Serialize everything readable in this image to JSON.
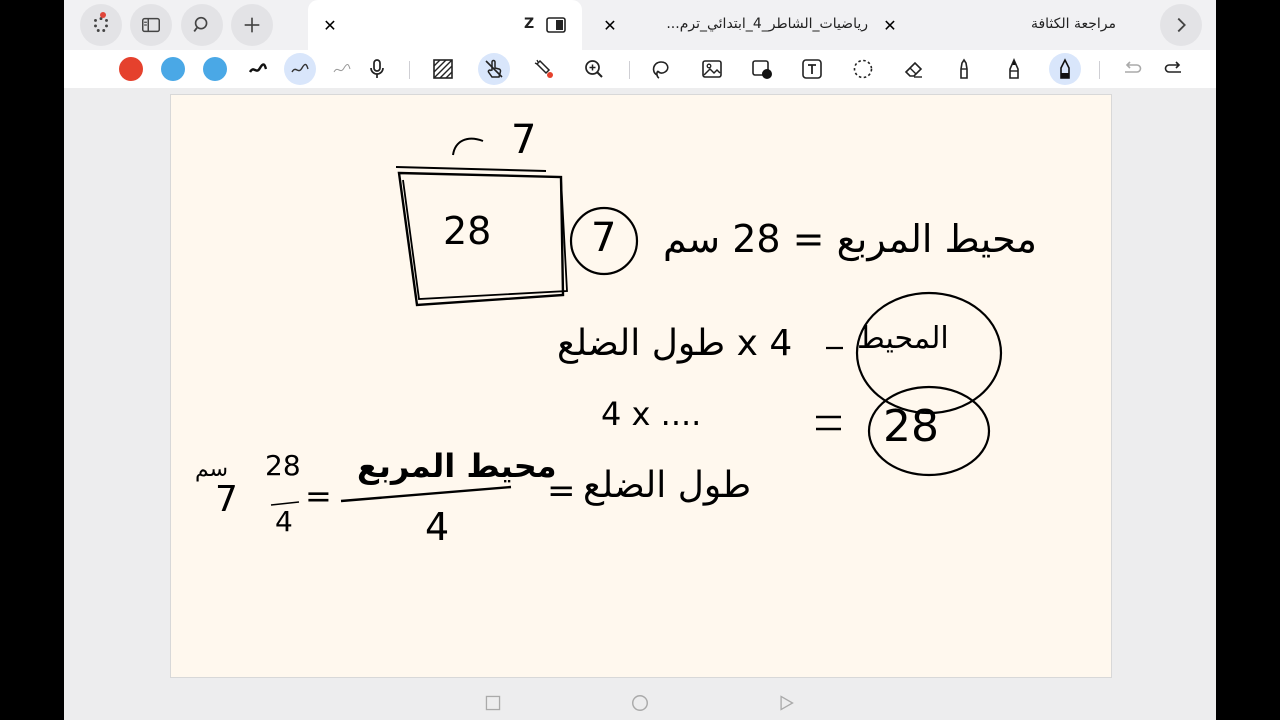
{
  "tabs": [
    {
      "title": "",
      "close": "✕",
      "active": true,
      "title_badge": "Z"
    },
    {
      "title": "رياضيات_الشاطر_4_ابتدائي_ترم...",
      "close": "✕",
      "active": false
    },
    {
      "title": "مراجعة الكثافة",
      "close": "",
      "active": false
    }
  ],
  "toolbar": {
    "colors": [
      "#e5412d",
      "#4aa8e6",
      "#4aa8e6"
    ],
    "tools": [
      "pen-stroke-black",
      "pen-stroke-selected",
      "pen-stroke-light",
      "microphone",
      "hatch",
      "finger-draw",
      "laser-pointer",
      "zoom",
      "lasso",
      "image",
      "camera",
      "text-box",
      "shapes",
      "eraser",
      "highlighter",
      "marker",
      "pen",
      "undo",
      "redo"
    ]
  },
  "page": {
    "square_value": "28",
    "square_side_top": "7",
    "circled_side": "7",
    "perimeter_text": "محيط المربع = 28 سم",
    "perimeter_label": "المحيط",
    "side_formula": "4 x طول الضلع",
    "equation_left": "28",
    "equation_right": "4 x ....",
    "side_label": "طول الضلع",
    "fraction_numerator": "محيط المربع",
    "fraction_denominator": "4",
    "small_fraction_numerator": "28",
    "small_fraction_denominator": "4",
    "result": "7",
    "result_unit": "سم",
    "equals": "="
  }
}
